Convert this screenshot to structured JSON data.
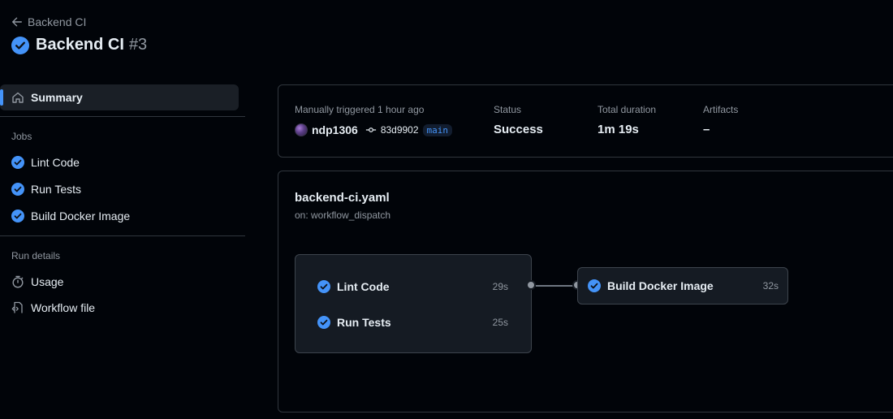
{
  "header": {
    "back_label": "Backend CI",
    "title": "Backend CI",
    "run_number": "#3"
  },
  "sidebar": {
    "summary_label": "Summary",
    "jobs_heading": "Jobs",
    "jobs": [
      {
        "label": "Lint Code",
        "status": "success"
      },
      {
        "label": "Run Tests",
        "status": "success"
      },
      {
        "label": "Build Docker Image",
        "status": "success"
      }
    ],
    "run_details_heading": "Run details",
    "details": [
      {
        "label": "Usage",
        "icon": "stopwatch-icon"
      },
      {
        "label": "Workflow file",
        "icon": "file-code-icon"
      }
    ]
  },
  "run_info": {
    "trigger_label": "Manually triggered 1 hour ago",
    "user": "ndp1306",
    "commit_sha": "83d9902",
    "branch": "main",
    "status_label": "Status",
    "status_value": "Success",
    "duration_label": "Total duration",
    "duration_value": "1m 19s",
    "artifacts_label": "Artifacts",
    "artifacts_value": "–"
  },
  "workflow": {
    "file_name": "backend-ci.yaml",
    "trigger": "on: workflow_dispatch",
    "graph_jobs": [
      {
        "name": "Lint Code",
        "duration": "29s"
      },
      {
        "name": "Run Tests",
        "duration": "25s"
      },
      {
        "name": "Build Docker Image",
        "duration": "32s"
      }
    ]
  },
  "colors": {
    "background": "#010409",
    "accent": "#4493f8",
    "border": "#30363d",
    "muted_text": "#9198a1"
  }
}
